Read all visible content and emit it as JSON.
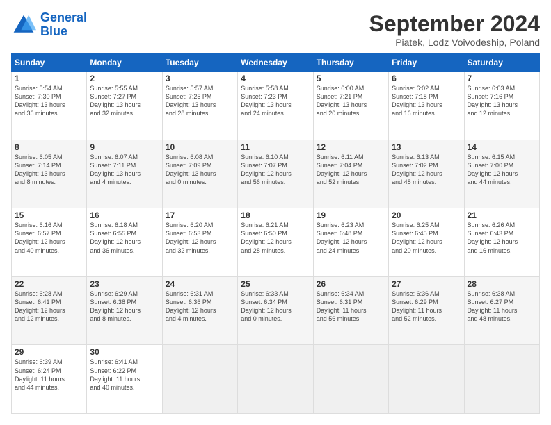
{
  "header": {
    "logo_line1": "General",
    "logo_line2": "Blue",
    "month": "September 2024",
    "location": "Piatek, Lodz Voivodeship, Poland"
  },
  "weekdays": [
    "Sunday",
    "Monday",
    "Tuesday",
    "Wednesday",
    "Thursday",
    "Friday",
    "Saturday"
  ],
  "weeks": [
    [
      {
        "day": "1",
        "info": "Sunrise: 5:54 AM\nSunset: 7:30 PM\nDaylight: 13 hours\nand 36 minutes."
      },
      {
        "day": "2",
        "info": "Sunrise: 5:55 AM\nSunset: 7:27 PM\nDaylight: 13 hours\nand 32 minutes."
      },
      {
        "day": "3",
        "info": "Sunrise: 5:57 AM\nSunset: 7:25 PM\nDaylight: 13 hours\nand 28 minutes."
      },
      {
        "day": "4",
        "info": "Sunrise: 5:58 AM\nSunset: 7:23 PM\nDaylight: 13 hours\nand 24 minutes."
      },
      {
        "day": "5",
        "info": "Sunrise: 6:00 AM\nSunset: 7:21 PM\nDaylight: 13 hours\nand 20 minutes."
      },
      {
        "day": "6",
        "info": "Sunrise: 6:02 AM\nSunset: 7:18 PM\nDaylight: 13 hours\nand 16 minutes."
      },
      {
        "day": "7",
        "info": "Sunrise: 6:03 AM\nSunset: 7:16 PM\nDaylight: 13 hours\nand 12 minutes."
      }
    ],
    [
      {
        "day": "8",
        "info": "Sunrise: 6:05 AM\nSunset: 7:14 PM\nDaylight: 13 hours\nand 8 minutes."
      },
      {
        "day": "9",
        "info": "Sunrise: 6:07 AM\nSunset: 7:11 PM\nDaylight: 13 hours\nand 4 minutes."
      },
      {
        "day": "10",
        "info": "Sunrise: 6:08 AM\nSunset: 7:09 PM\nDaylight: 13 hours\nand 0 minutes."
      },
      {
        "day": "11",
        "info": "Sunrise: 6:10 AM\nSunset: 7:07 PM\nDaylight: 12 hours\nand 56 minutes."
      },
      {
        "day": "12",
        "info": "Sunrise: 6:11 AM\nSunset: 7:04 PM\nDaylight: 12 hours\nand 52 minutes."
      },
      {
        "day": "13",
        "info": "Sunrise: 6:13 AM\nSunset: 7:02 PM\nDaylight: 12 hours\nand 48 minutes."
      },
      {
        "day": "14",
        "info": "Sunrise: 6:15 AM\nSunset: 7:00 PM\nDaylight: 12 hours\nand 44 minutes."
      }
    ],
    [
      {
        "day": "15",
        "info": "Sunrise: 6:16 AM\nSunset: 6:57 PM\nDaylight: 12 hours\nand 40 minutes."
      },
      {
        "day": "16",
        "info": "Sunrise: 6:18 AM\nSunset: 6:55 PM\nDaylight: 12 hours\nand 36 minutes."
      },
      {
        "day": "17",
        "info": "Sunrise: 6:20 AM\nSunset: 6:53 PM\nDaylight: 12 hours\nand 32 minutes."
      },
      {
        "day": "18",
        "info": "Sunrise: 6:21 AM\nSunset: 6:50 PM\nDaylight: 12 hours\nand 28 minutes."
      },
      {
        "day": "19",
        "info": "Sunrise: 6:23 AM\nSunset: 6:48 PM\nDaylight: 12 hours\nand 24 minutes."
      },
      {
        "day": "20",
        "info": "Sunrise: 6:25 AM\nSunset: 6:45 PM\nDaylight: 12 hours\nand 20 minutes."
      },
      {
        "day": "21",
        "info": "Sunrise: 6:26 AM\nSunset: 6:43 PM\nDaylight: 12 hours\nand 16 minutes."
      }
    ],
    [
      {
        "day": "22",
        "info": "Sunrise: 6:28 AM\nSunset: 6:41 PM\nDaylight: 12 hours\nand 12 minutes."
      },
      {
        "day": "23",
        "info": "Sunrise: 6:29 AM\nSunset: 6:38 PM\nDaylight: 12 hours\nand 8 minutes."
      },
      {
        "day": "24",
        "info": "Sunrise: 6:31 AM\nSunset: 6:36 PM\nDaylight: 12 hours\nand 4 minutes."
      },
      {
        "day": "25",
        "info": "Sunrise: 6:33 AM\nSunset: 6:34 PM\nDaylight: 12 hours\nand 0 minutes."
      },
      {
        "day": "26",
        "info": "Sunrise: 6:34 AM\nSunset: 6:31 PM\nDaylight: 11 hours\nand 56 minutes."
      },
      {
        "day": "27",
        "info": "Sunrise: 6:36 AM\nSunset: 6:29 PM\nDaylight: 11 hours\nand 52 minutes."
      },
      {
        "day": "28",
        "info": "Sunrise: 6:38 AM\nSunset: 6:27 PM\nDaylight: 11 hours\nand 48 minutes."
      }
    ],
    [
      {
        "day": "29",
        "info": "Sunrise: 6:39 AM\nSunset: 6:24 PM\nDaylight: 11 hours\nand 44 minutes."
      },
      {
        "day": "30",
        "info": "Sunrise: 6:41 AM\nSunset: 6:22 PM\nDaylight: 11 hours\nand 40 minutes."
      },
      {
        "day": "",
        "info": ""
      },
      {
        "day": "",
        "info": ""
      },
      {
        "day": "",
        "info": ""
      },
      {
        "day": "",
        "info": ""
      },
      {
        "day": "",
        "info": ""
      }
    ]
  ]
}
